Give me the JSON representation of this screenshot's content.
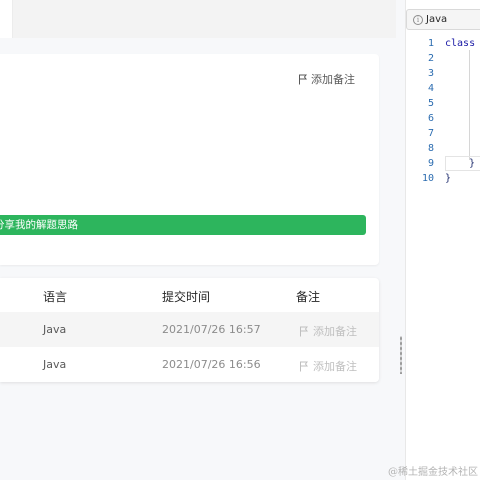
{
  "notes_panel": {
    "add_note_label": "添加备注",
    "share_label": "分享我的解题思路"
  },
  "submissions": {
    "headers": {
      "language": "语言",
      "submit_time": "提交时间",
      "note": "备注"
    },
    "rows": [
      {
        "language": "Java",
        "time": "2021/07/26 16:57",
        "note": "添加备注"
      },
      {
        "language": "Java",
        "time": "2021/07/26 16:56",
        "note": "添加备注"
      }
    ]
  },
  "editor": {
    "language": "Java",
    "line_numbers": [
      "1",
      "2",
      "3",
      "4",
      "5",
      "6",
      "7",
      "8",
      "9",
      "10"
    ],
    "lines": [
      "class",
      "",
      "",
      "",
      "",
      "",
      "",
      "",
      "}",
      "}"
    ]
  },
  "watermark": "@稀土掘金技术社区",
  "colors": {
    "accent": "#2db55d",
    "line_number": "#2b6cb0"
  }
}
